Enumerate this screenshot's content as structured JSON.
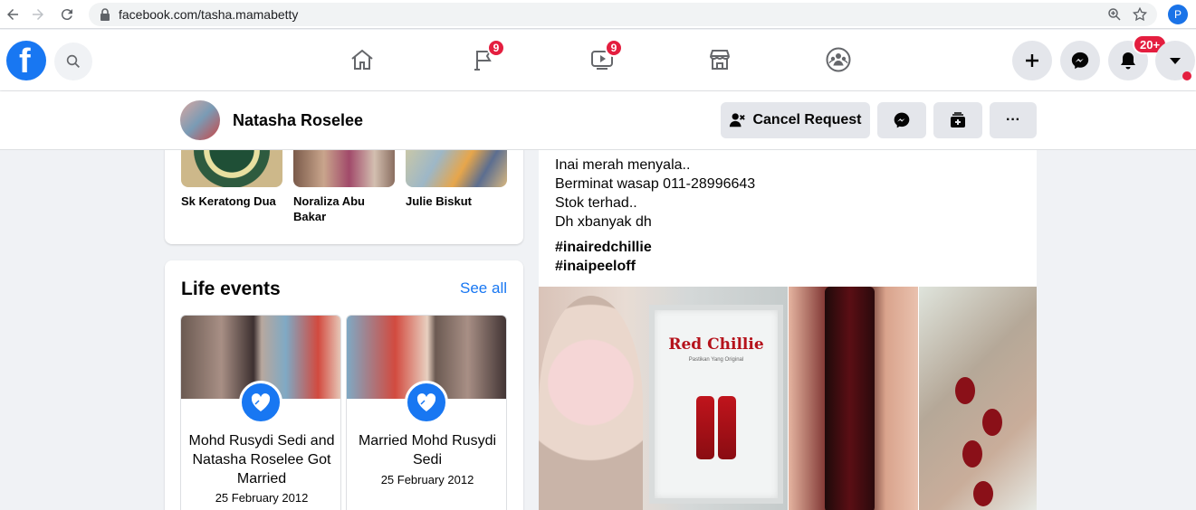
{
  "browser": {
    "url": "facebook.com/tasha.mamabetty",
    "profile_initial": "P"
  },
  "header": {
    "logo": "f",
    "nav": [
      {
        "name": "home",
        "icon": "home-icon",
        "badge": ""
      },
      {
        "name": "pages",
        "icon": "flag-icon",
        "badge": "9"
      },
      {
        "name": "watch",
        "icon": "video-icon",
        "badge": "9"
      },
      {
        "name": "marketplace",
        "icon": "store-icon",
        "badge": ""
      },
      {
        "name": "groups",
        "icon": "groups-icon",
        "badge": ""
      }
    ],
    "notifications_badge": "20+"
  },
  "profile_bar": {
    "name": "Natasha Roselee",
    "cancel_request_label": "Cancel Request",
    "more_label": "···"
  },
  "friends": [
    {
      "name": "Sk Keratong Dua"
    },
    {
      "name": "Noraliza Abu Bakar"
    },
    {
      "name": "Julie Biskut"
    }
  ],
  "life_events": {
    "title": "Life events",
    "see_all": "See all",
    "items": [
      {
        "title": "Mohd Rusydi Sedi and Natasha Roselee Got Married",
        "date": "25 February 2012"
      },
      {
        "title": "Married Mohd Rusydi Sedi",
        "date": "25 February 2012"
      }
    ]
  },
  "post": {
    "lines": [
      "Inai merah menyala..",
      "Berminat wasap 011-28996643",
      "Stok terhad..",
      "Dh xbanyak dh"
    ],
    "hashtags": [
      "#inairedchillie",
      "#inaipeeloff"
    ],
    "image_text": {
      "brand": "Red Chillie",
      "tagline": "Pastikan Yang Original"
    }
  },
  "colors": {
    "brand": "#1877f2",
    "badge": "#e41e3f",
    "background": "#f0f2f5"
  }
}
